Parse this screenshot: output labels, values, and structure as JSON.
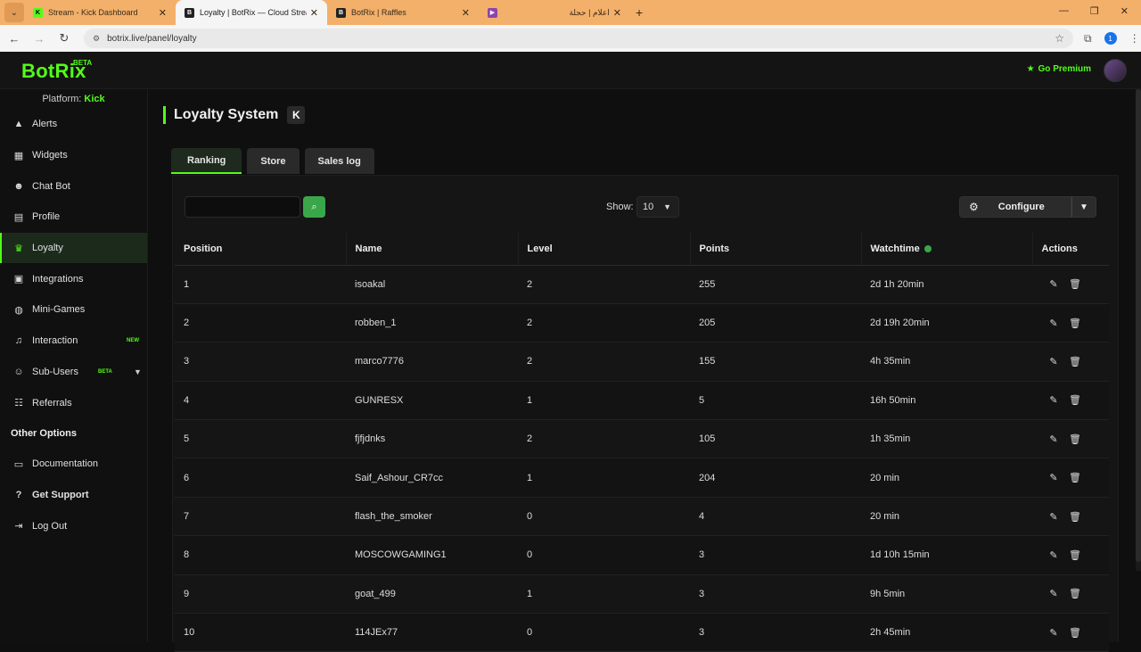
{
  "browser": {
    "tabs": [
      {
        "title": "Stream - Kick Dashboard",
        "fav": "K",
        "fav_color": "#53fc18"
      },
      {
        "title": "Loyalty | BotRix — Cloud Stream",
        "fav": "B",
        "fav_color": "#222222",
        "active": true
      },
      {
        "title": "BotRix | Raffles",
        "fav": "B",
        "fav_color": "#222222"
      },
      {
        "title": "اعلام | حجلة",
        "fav": "▶",
        "fav_color": "#8e44ad"
      }
    ],
    "url": "botrix.live/panel/loyalty",
    "profile_initial": "1"
  },
  "header": {
    "logo": "BotRix",
    "logo_badge": "BETA",
    "premium_label": "Go Premium"
  },
  "sidebar": {
    "platform_label": "Platform:",
    "platform_value": "Kick",
    "items": [
      {
        "label": "Alerts",
        "icon": "warning-icon"
      },
      {
        "label": "Widgets",
        "icon": "widgets-icon"
      },
      {
        "label": "Chat Bot",
        "icon": "robot-icon"
      },
      {
        "label": "Profile",
        "icon": "profile-card-icon"
      },
      {
        "label": "Loyalty",
        "icon": "trophy-icon",
        "active": true
      },
      {
        "label": "Integrations",
        "icon": "integrations-icon"
      },
      {
        "label": "Mini-Games",
        "icon": "gamepad-icon"
      },
      {
        "label": "Interaction",
        "icon": "music-icon",
        "badge": "NEW"
      },
      {
        "label": "Sub-Users",
        "icon": "users-icon",
        "badge": "BETA"
      },
      {
        "label": "Referrals",
        "icon": "referrals-icon"
      }
    ],
    "other_title": "Other Options",
    "other_items": [
      {
        "label": "Documentation",
        "icon": "document-icon"
      },
      {
        "label": "Get Support",
        "icon": "help-icon"
      },
      {
        "label": "Log Out",
        "icon": "logout-icon"
      }
    ]
  },
  "main": {
    "title": "Loyalty System",
    "kick_badge": "K",
    "tabs": [
      "Ranking",
      "Store",
      "Sales log"
    ],
    "show_label": "Show:",
    "show_value": "10",
    "configure_label": "Configure",
    "columns": [
      "Position",
      "Name",
      "Level",
      "Points",
      "Watchtime",
      "Actions"
    ],
    "rows": [
      {
        "position": "1",
        "name": "isoakal",
        "level": "2",
        "points": "255",
        "watchtime": "2d 1h 20min"
      },
      {
        "position": "2",
        "name": "robben_1",
        "level": "2",
        "points": "205",
        "watchtime": "2d 19h 20min"
      },
      {
        "position": "3",
        "name": "marco7776",
        "level": "2",
        "points": "155",
        "watchtime": "4h 35min"
      },
      {
        "position": "4",
        "name": "GUNRESX",
        "level": "1",
        "points": "5",
        "watchtime": "16h 50min"
      },
      {
        "position": "5",
        "name": "fjfjdnks",
        "level": "2",
        "points": "105",
        "watchtime": "1h 35min"
      },
      {
        "position": "6",
        "name": "Saif_Ashour_CR7cc",
        "level": "1",
        "points": "204",
        "watchtime": "20 min"
      },
      {
        "position": "7",
        "name": "flash_the_smoker",
        "level": "0",
        "points": "4",
        "watchtime": "20 min"
      },
      {
        "position": "8",
        "name": "MOSCOWGAMING1",
        "level": "0",
        "points": "3",
        "watchtime": "1d 10h 15min"
      },
      {
        "position": "9",
        "name": "goat_499",
        "level": "1",
        "points": "3",
        "watchtime": "9h 5min"
      },
      {
        "position": "10",
        "name": "114JEx77",
        "level": "0",
        "points": "3",
        "watchtime": "2h 45min"
      }
    ]
  },
  "colors": {
    "accent": "#53fc18",
    "button_green": "#3aa64a",
    "tabbar": "#f3b06a"
  }
}
